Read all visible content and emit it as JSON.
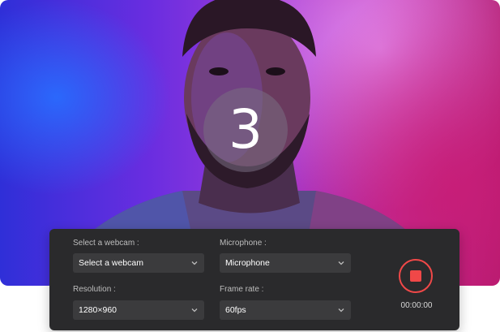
{
  "countdown": "3",
  "panel": {
    "webcam": {
      "label": "Select a webcam :",
      "value": "Select a  webcam"
    },
    "microphone": {
      "label": "Microphone :",
      "value": "Microphone"
    },
    "resolution": {
      "label": "Resolution :",
      "value": "1280×960"
    },
    "frame_rate": {
      "label": "Frame rate :",
      "value": "60fps"
    },
    "timer": "00:00:00"
  },
  "icons": {
    "record": "stop-icon",
    "dropdown": "chevron-down-icon"
  },
  "colors": {
    "record_accent": "#f04848",
    "panel_bg": "#2a2a2c",
    "select_bg": "#3b3b3d"
  }
}
